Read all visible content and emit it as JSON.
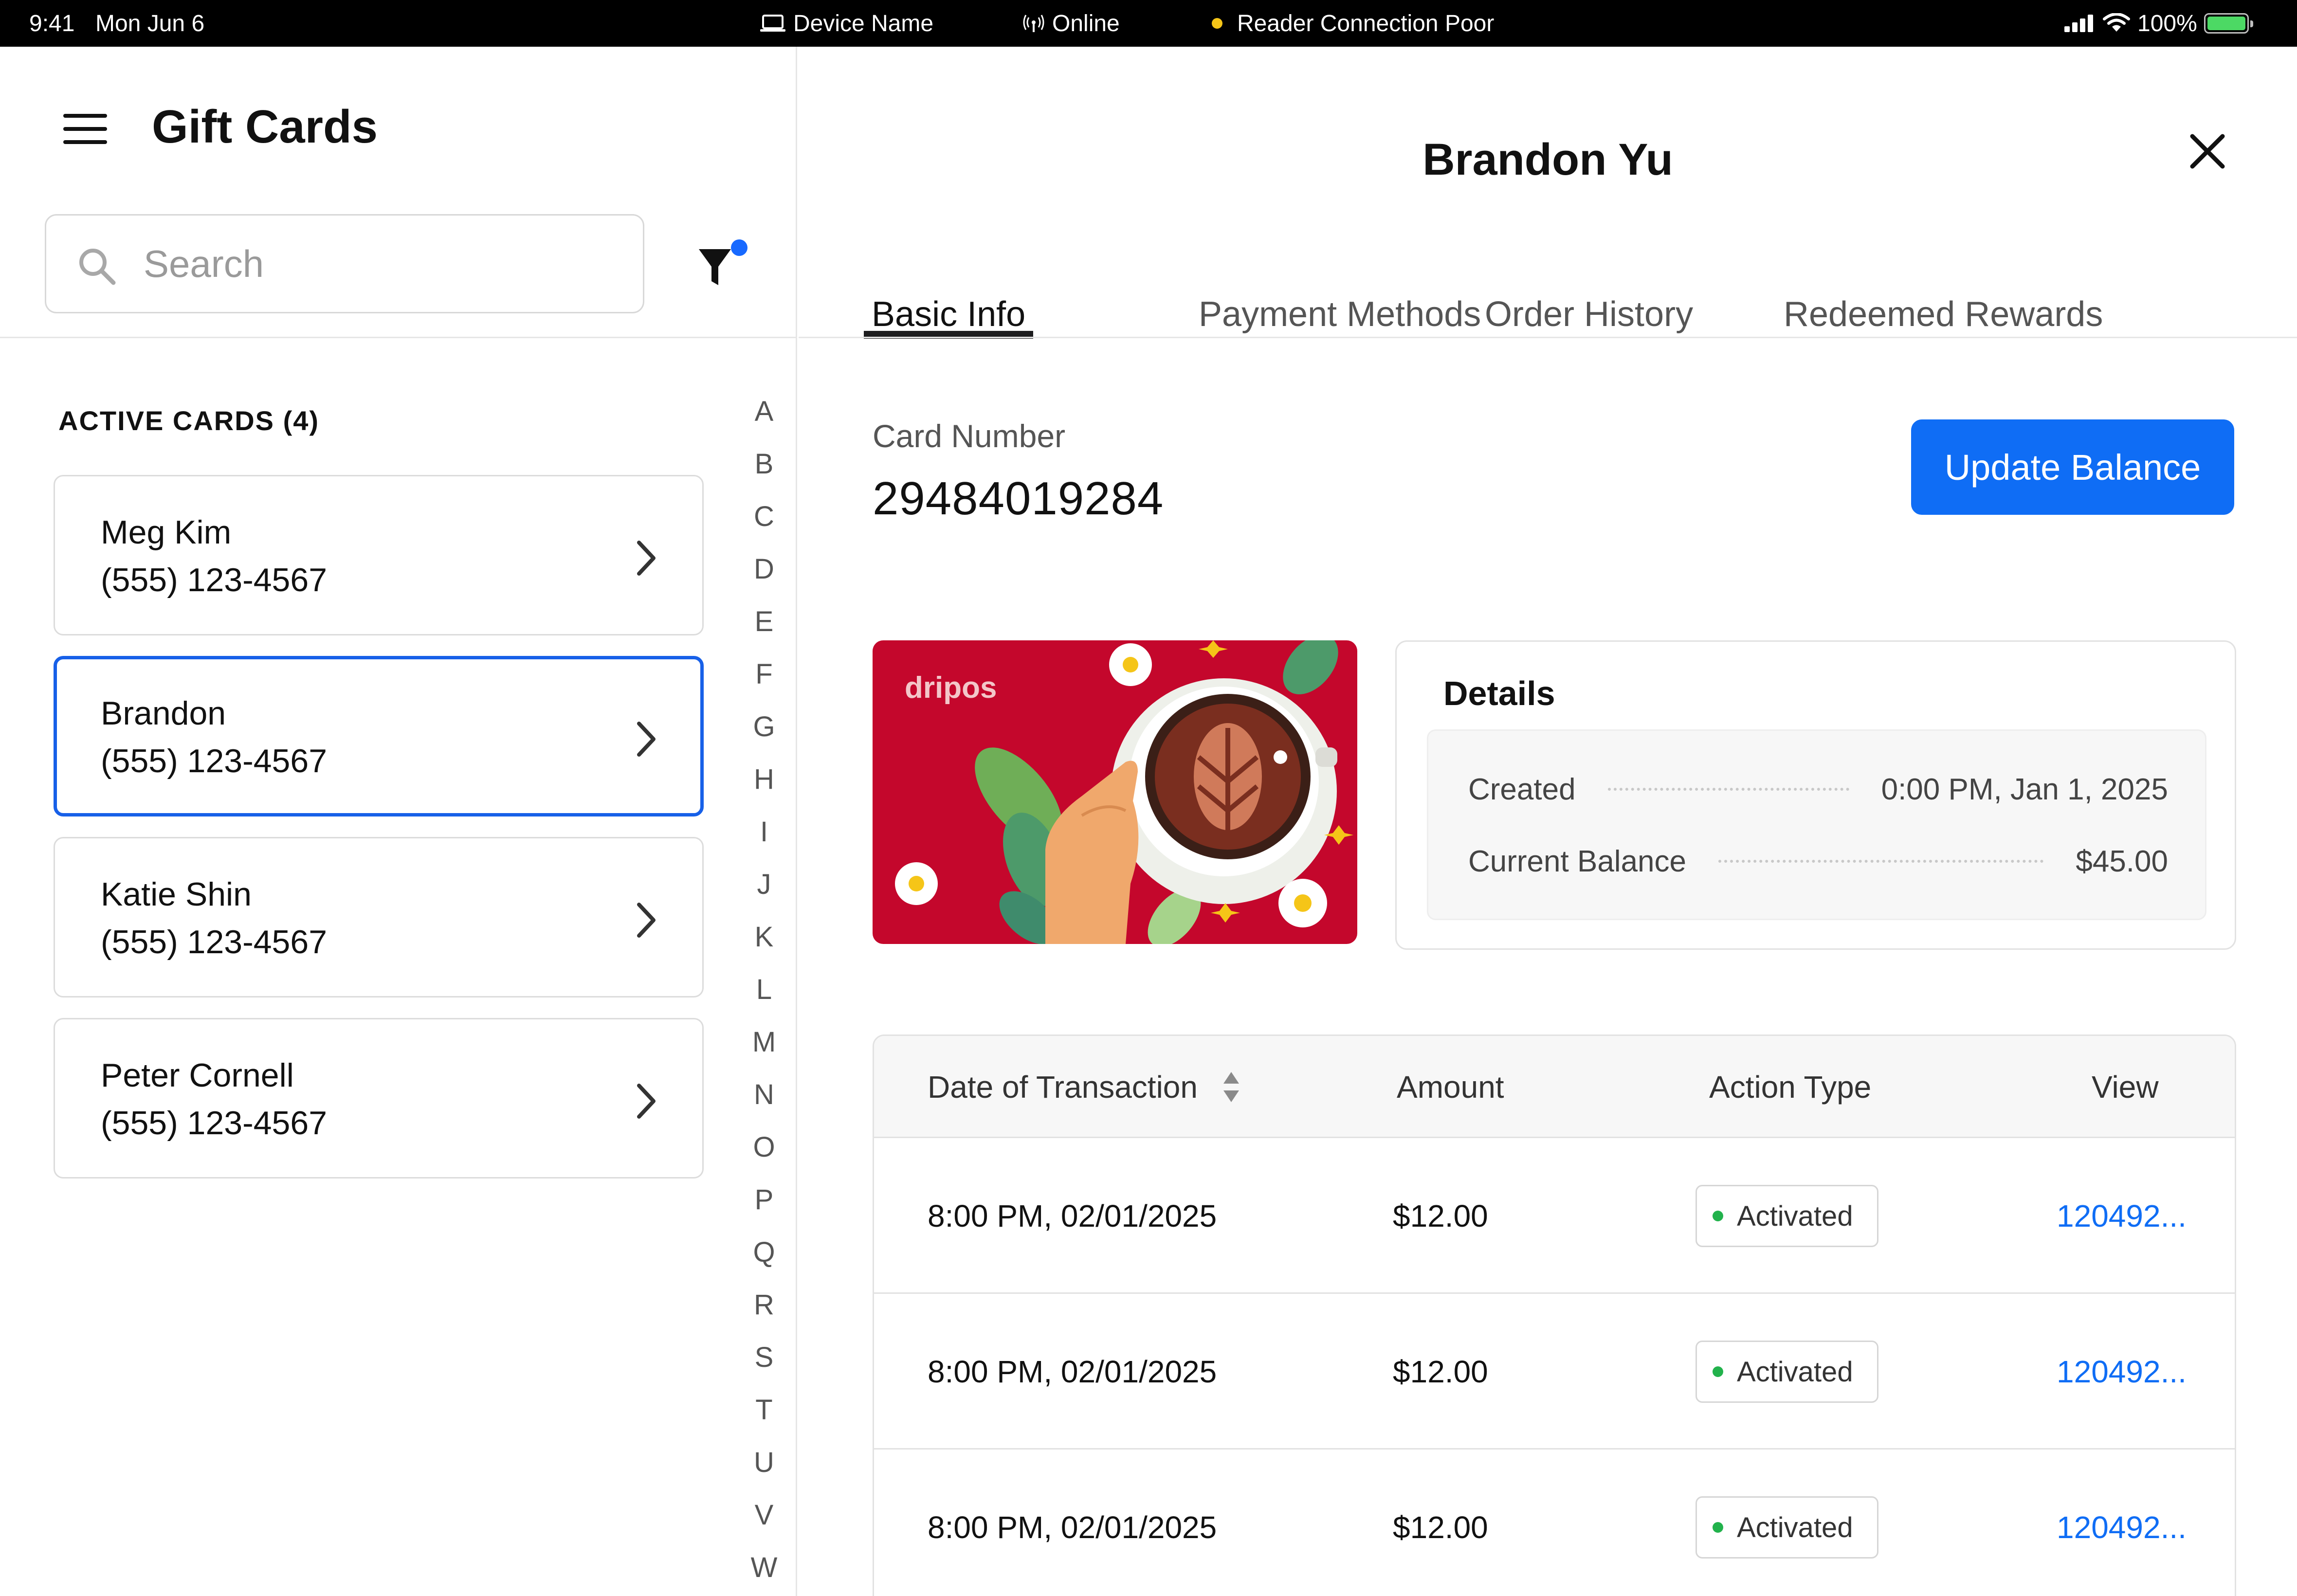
{
  "status_bar": {
    "time": "9:41",
    "date": "Mon Jun 6",
    "device": "Device Name",
    "online": "Online",
    "reader": "Reader Connection Poor",
    "battery": "100%",
    "reader_color": "#f5c518"
  },
  "left_panel": {
    "title": "Gift Cards",
    "search_placeholder": "Search",
    "filter_active_color": "#1769ff",
    "section_label": "ACTIVE CARDS (4)",
    "cards": [
      {
        "name": "Meg Kim",
        "phone": "(555) 123-4567",
        "selected": false
      },
      {
        "name": "Brandon",
        "phone": "(555) 123-4567",
        "selected": true
      },
      {
        "name": "Katie Shin",
        "phone": "(555) 123-4567",
        "selected": false
      },
      {
        "name": "Peter Cornell",
        "phone": "(555) 123-4567",
        "selected": false
      }
    ],
    "alphabet": [
      "A",
      "B",
      "C",
      "D",
      "E",
      "F",
      "G",
      "H",
      "I",
      "J",
      "K",
      "L",
      "M",
      "N",
      "O",
      "P",
      "Q",
      "R",
      "S",
      "T",
      "U",
      "V",
      "W"
    ]
  },
  "detail": {
    "title": "Brandon Yu",
    "tabs": [
      "Basic Info",
      "Payment Methods",
      "Order History",
      "Redeemed Rewards"
    ],
    "active_tab": "Basic Info",
    "card_number_label": "Card Number",
    "card_number": "29484019284",
    "update_button": "Update Balance",
    "accent_color": "#0f6df5",
    "gift_card_brand": "dripos",
    "details": {
      "title": "Details",
      "created_label": "Created",
      "created_value": "0:00 PM, Jan 1, 2025",
      "balance_label": "Current Balance",
      "balance_value": "$45.00"
    },
    "table": {
      "headers": {
        "date": "Date of Transaction",
        "amount": "Amount",
        "action": "Action Type",
        "view": "View"
      },
      "rows": [
        {
          "date": "8:00 PM, 02/01/2025",
          "amount": "$12.00",
          "action": "Activated",
          "view": "120492..."
        },
        {
          "date": "8:00 PM, 02/01/2025",
          "amount": "$12.00",
          "action": "Activated",
          "view": "120492..."
        },
        {
          "date": "8:00 PM, 02/01/2025",
          "amount": "$12.00",
          "action": "Activated",
          "view": "120492..."
        }
      ]
    }
  }
}
